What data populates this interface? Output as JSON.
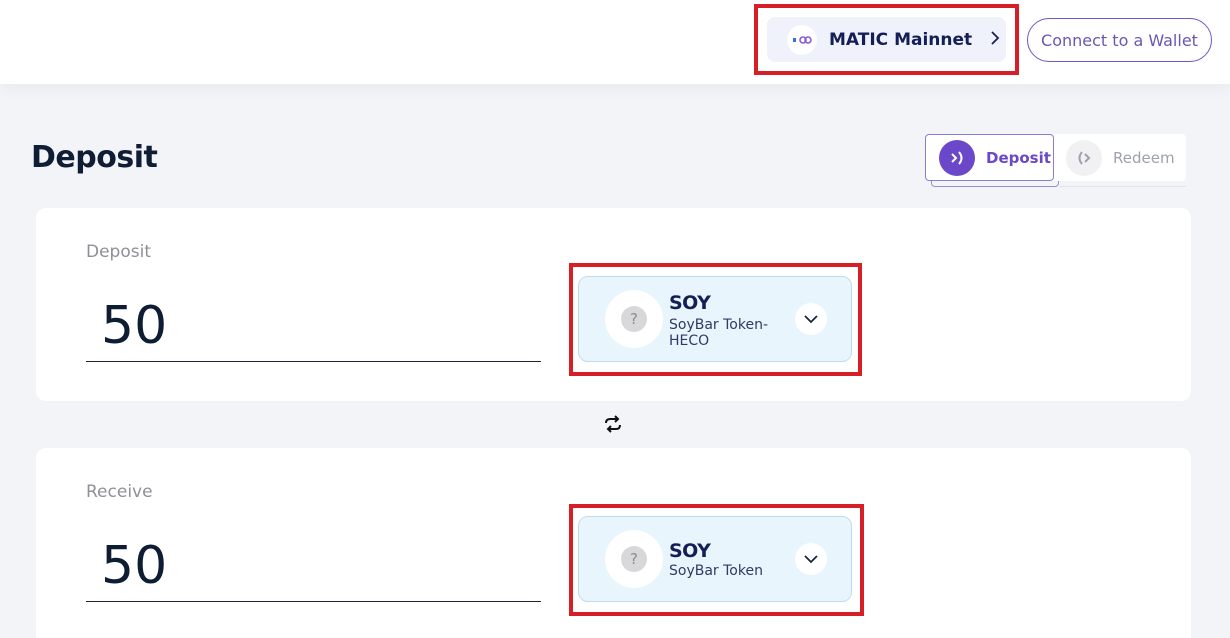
{
  "header": {
    "network": {
      "name": "MATIC Mainnet",
      "logo_icon": "polygon-logo-icon"
    },
    "connect_wallet_label": "Connect to a Wallet"
  },
  "page": {
    "title": "Deposit",
    "modes": [
      {
        "label": "Deposit",
        "active": true,
        "icon": "deposit-icon"
      },
      {
        "label": "Redeem",
        "active": false,
        "icon": "redeem-icon"
      }
    ]
  },
  "deposit_card": {
    "label": "Deposit",
    "amount": "50",
    "token": {
      "symbol": "SOY",
      "name": "SoyBar Token-HECO",
      "icon": "unknown-token-icon"
    }
  },
  "receive_card": {
    "label": "Receive",
    "amount": "50",
    "token": {
      "symbol": "SOY",
      "name": "SoyBar Token",
      "icon": "unknown-token-icon"
    }
  },
  "colors": {
    "accent": "#6a48c9",
    "highlight": "#d61f26",
    "token_box_bg": "#e9f5fd"
  }
}
